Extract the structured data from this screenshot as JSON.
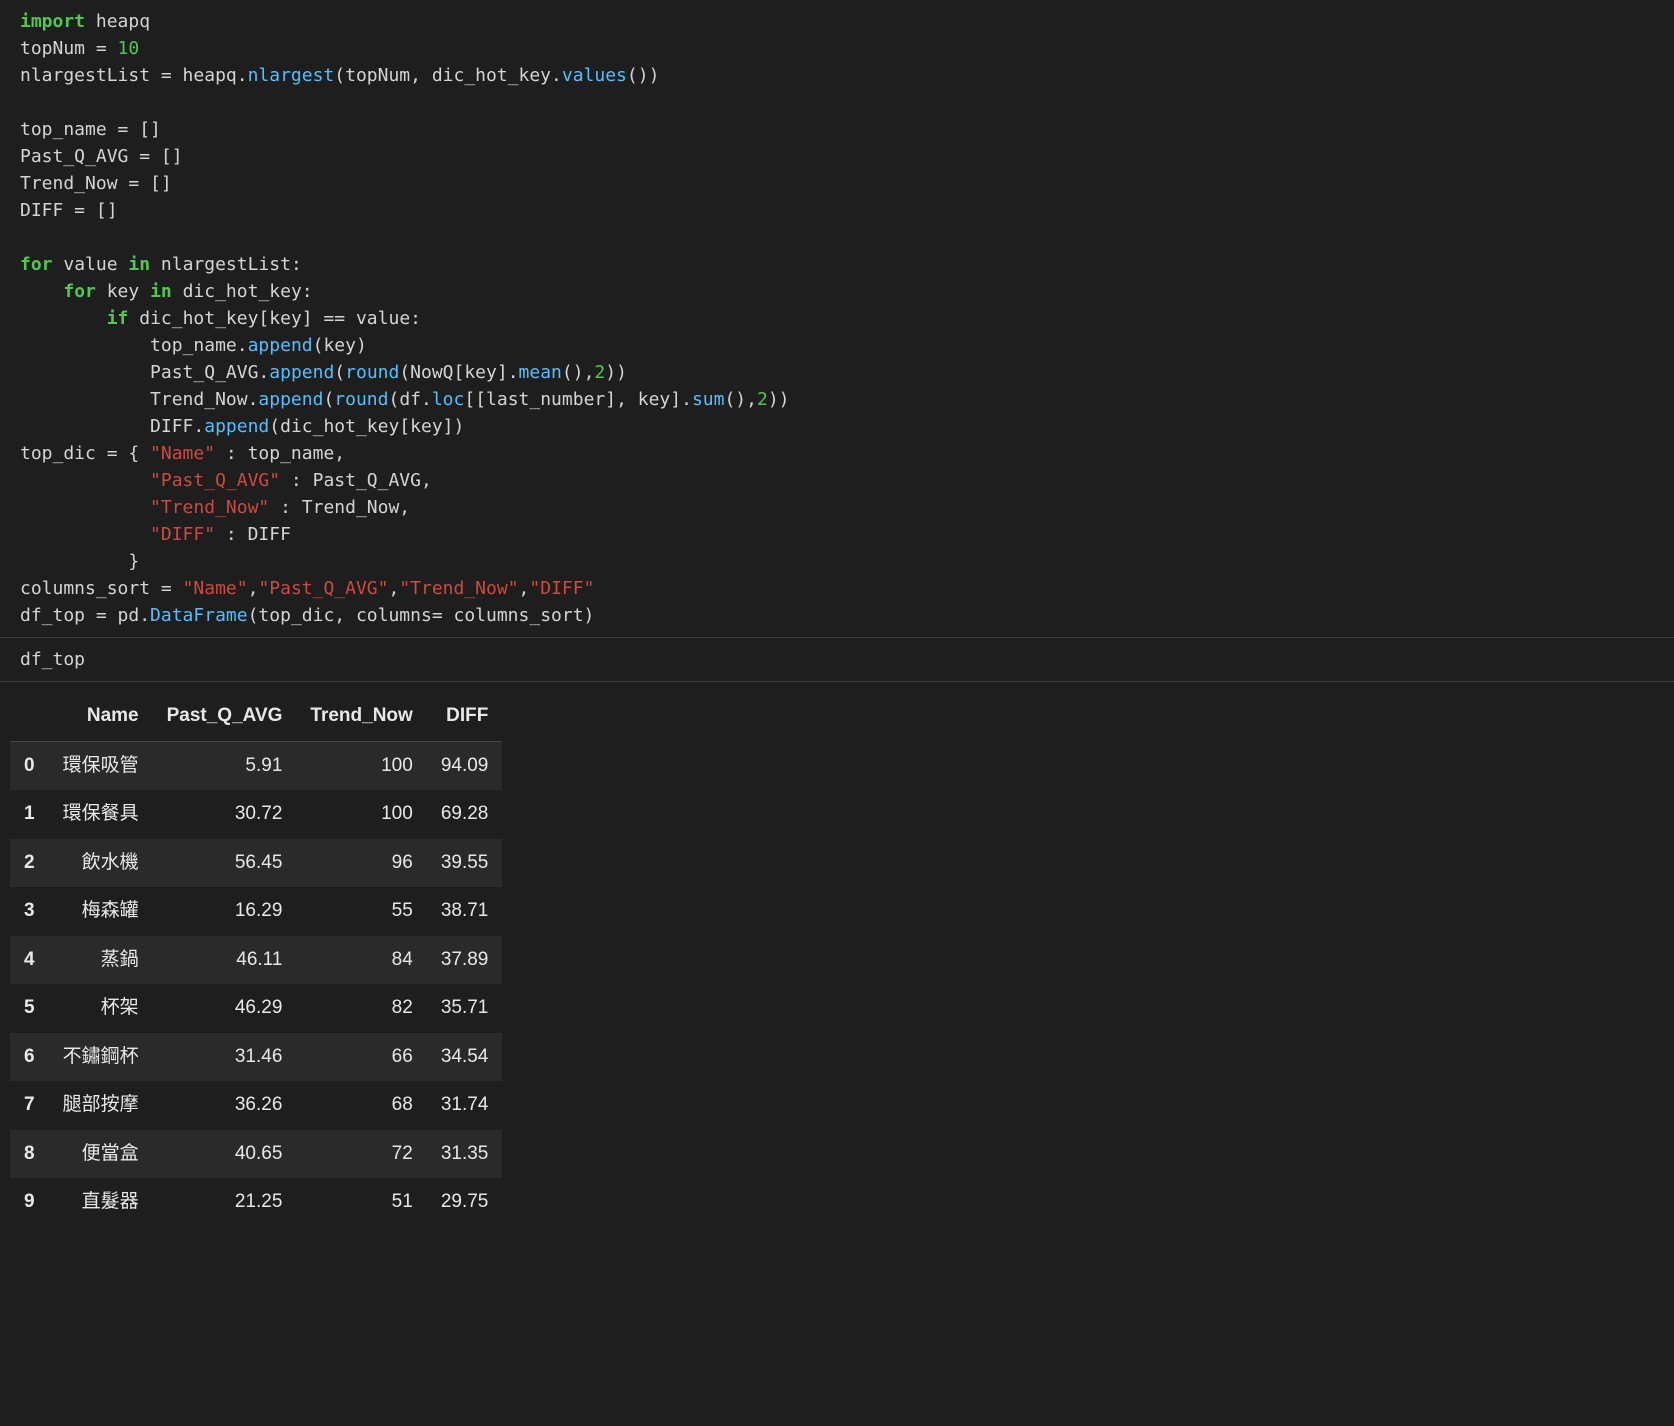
{
  "code_cell_1": {
    "l1": {
      "kw": "import",
      "rest": " heapq"
    },
    "l2": {
      "a": "topNum = ",
      "num": "10"
    },
    "l3": {
      "a": "nlargestList = heapq.",
      "fn": "nlargest",
      "b": "(topNum, dic_hot_key.",
      "fn2": "values",
      "c": "())"
    },
    "l4": "",
    "l5": "top_name = []",
    "l6": "Past_Q_AVG = []",
    "l7": "Trend_Now = []",
    "l8": "DIFF = []",
    "l9": "",
    "l10": {
      "kw": "for",
      "a": " value ",
      "kw2": "in",
      "b": " nlargestList:"
    },
    "l11": {
      "pad": "    ",
      "kw": "for",
      "a": " key ",
      "kw2": "in",
      "b": " dic_hot_key:"
    },
    "l12": {
      "pad": "        ",
      "kw": "if",
      "a": " dic_hot_key[key] == value:"
    },
    "l13": {
      "pad": "            ",
      "a": "top_name.",
      "fn": "append",
      "b": "(key)"
    },
    "l14": {
      "pad": "            ",
      "a": "Past_Q_AVG.",
      "fn": "append",
      "b": "(",
      "fn2": "round",
      "c": "(NowQ[key].",
      "fn3": "mean",
      "d": "(),",
      "num": "2",
      "e": "))"
    },
    "l15": {
      "pad": "            ",
      "a": "Trend_Now.",
      "fn": "append",
      "b": "(",
      "fn2": "round",
      "c": "(df.",
      "fn3": "loc",
      "d": "[[last_number], key].",
      "fn4": "sum",
      "e": "(),",
      "num": "2",
      "f": "))"
    },
    "l16": {
      "pad": "            ",
      "a": "DIFF.",
      "fn": "append",
      "b": "(dic_hot_key[key])"
    },
    "l17": {
      "a": "top_dic = { ",
      "s": "\"Name\"",
      "b": " : top_name,"
    },
    "l18": {
      "pad": "            ",
      "s": "\"Past_Q_AVG\"",
      "a": " : Past_Q_AVG,"
    },
    "l19": {
      "pad": "            ",
      "s": "\"Trend_Now\"",
      "a": " : Trend_Now,"
    },
    "l20": {
      "pad": "            ",
      "s": "\"DIFF\"",
      "a": " : DIFF"
    },
    "l21": {
      "pad": "          ",
      "a": "}"
    },
    "l22": {
      "a": "columns_sort = ",
      "s1": "\"Name\"",
      "c1": ",",
      "s2": "\"Past_Q_AVG\"",
      "c2": ",",
      "s3": "\"Trend_Now\"",
      "c3": ",",
      "s4": "\"DIFF\""
    },
    "l23": {
      "a": "df_top = pd.",
      "fn": "DataFrame",
      "b": "(top_dic, columns= columns_sort)"
    }
  },
  "code_cell_2": "df_top",
  "table": {
    "columns": [
      "Name",
      "Past_Q_AVG",
      "Trend_Now",
      "DIFF"
    ],
    "rows": [
      {
        "idx": "0",
        "Name": "環保吸管",
        "Past_Q_AVG": "5.91",
        "Trend_Now": "100",
        "DIFF": "94.09"
      },
      {
        "idx": "1",
        "Name": "環保餐具",
        "Past_Q_AVG": "30.72",
        "Trend_Now": "100",
        "DIFF": "69.28"
      },
      {
        "idx": "2",
        "Name": "飲水機",
        "Past_Q_AVG": "56.45",
        "Trend_Now": "96",
        "DIFF": "39.55"
      },
      {
        "idx": "3",
        "Name": "梅森罐",
        "Past_Q_AVG": "16.29",
        "Trend_Now": "55",
        "DIFF": "38.71"
      },
      {
        "idx": "4",
        "Name": "蒸鍋",
        "Past_Q_AVG": "46.11",
        "Trend_Now": "84",
        "DIFF": "37.89"
      },
      {
        "idx": "5",
        "Name": "杯架",
        "Past_Q_AVG": "46.29",
        "Trend_Now": "82",
        "DIFF": "35.71"
      },
      {
        "idx": "6",
        "Name": "不鏽鋼杯",
        "Past_Q_AVG": "31.46",
        "Trend_Now": "66",
        "DIFF": "34.54"
      },
      {
        "idx": "7",
        "Name": "腿部按摩",
        "Past_Q_AVG": "36.26",
        "Trend_Now": "68",
        "DIFF": "31.74"
      },
      {
        "idx": "8",
        "Name": "便當盒",
        "Past_Q_AVG": "40.65",
        "Trend_Now": "72",
        "DIFF": "31.35"
      },
      {
        "idx": "9",
        "Name": "直髮器",
        "Past_Q_AVG": "21.25",
        "Trend_Now": "51",
        "DIFF": "29.75"
      }
    ]
  }
}
